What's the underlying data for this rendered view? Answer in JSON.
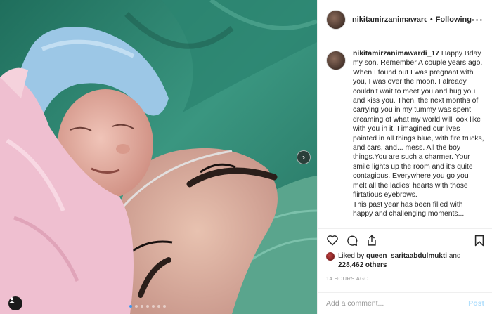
{
  "header": {
    "username": "nikitamirzanimawardi_",
    "separator": "•",
    "follow_label": "Following",
    "more_icon": "more-icon"
  },
  "caption": {
    "username": "nikitamirzanimawardi_17",
    "text": "Happy Bday my son. Remember A couple years ago, When I found out I was pregnant with you, I was over the moon. I already couldn't wait to meet you and hug you and kiss you. Then, the next months of carrying you in my tummy was spent dreaming of what my world will look like with you in it. I imagined our lives painted in all things blue, with fire trucks, and cars, and... mess. All the boy things.You are such a charmer. Your smile lights up the room and it's quite contagious. Everywhere you go you melt all the ladies' hearts with those flirtatious eyebrows.\nThis past year has been filled with happy and challenging moments..."
  },
  "likes": {
    "prefix": "Liked by",
    "user": "queen_saritaabdulmukti",
    "and": "and",
    "count": "228,462 others"
  },
  "timestamp": "14 HOURS AGO",
  "comment": {
    "placeholder": "Add a comment...",
    "post_label": "Post"
  },
  "carousel": {
    "total_slides": 7,
    "active_index": 0
  },
  "colors": {
    "link_blue": "#3897f0",
    "post_disabled": "#b2dffc"
  }
}
